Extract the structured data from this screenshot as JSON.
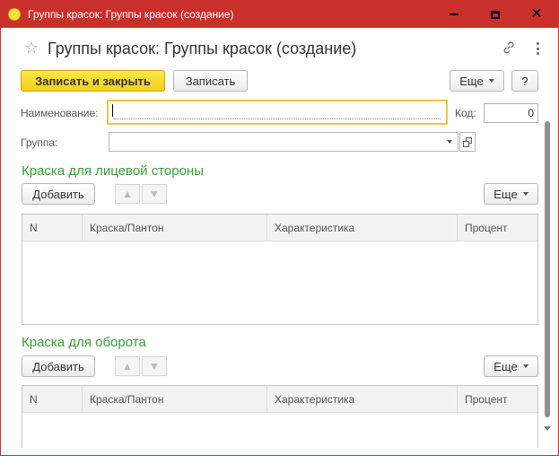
{
  "window": {
    "title": "Группы красок: Группы красок (создание)",
    "controls": {
      "minimize": "minimize-icon",
      "maximize": "maximize-icon",
      "close": "close-icon"
    }
  },
  "header": {
    "title": "Группы красок: Группы красок (создание)"
  },
  "toolbar": {
    "save_close_label": "Записать и закрыть",
    "save_label": "Записать",
    "more_label": "Еще",
    "help_label": "?"
  },
  "fields": {
    "name_label": "Наименование:",
    "name_value": "",
    "code_label": "Код:",
    "code_value": "0",
    "group_label": "Группа:",
    "group_value": ""
  },
  "sections": [
    {
      "title": "Краска для лицевой стороны",
      "add_label": "Добавить",
      "more_label": "Еще",
      "columns": [
        "N",
        "Краска/Пантон",
        "Характеристика",
        "Процент"
      ]
    },
    {
      "title": "Краска для оборота",
      "add_label": "Добавить",
      "more_label": "Еще",
      "columns": [
        "N",
        "Краска/Пантон",
        "Характеристика",
        "Процент"
      ]
    }
  ],
  "colors": {
    "titlebar": "#c9302c",
    "primary_button": "#f4cf1a",
    "section_title": "#3a9e3a",
    "focus_border": "#e6c84a"
  }
}
